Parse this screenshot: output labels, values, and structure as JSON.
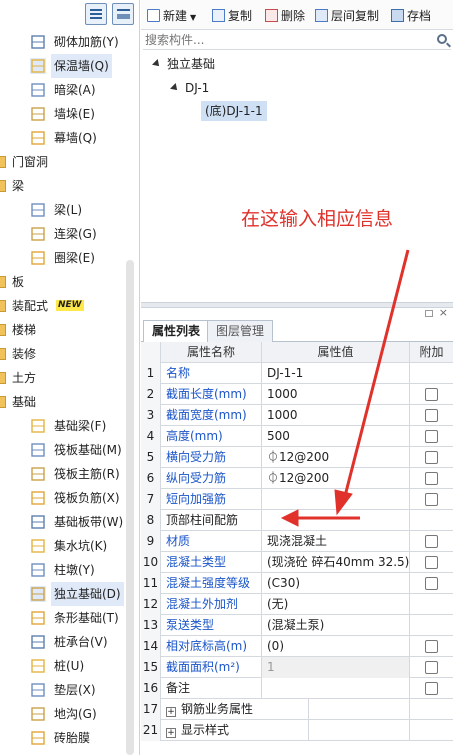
{
  "left_tree": {
    "items": [
      {
        "kind": "sub",
        "label": "砌体加筋(Y)",
        "icon": "masonry-rebar-icon"
      },
      {
        "kind": "sub",
        "label": "保温墙(Q)",
        "icon": "insulation-wall-icon",
        "selected": true
      },
      {
        "kind": "sub",
        "label": "暗梁(A)",
        "icon": "hidden-beam-icon"
      },
      {
        "kind": "sub",
        "label": "墙垛(E)",
        "icon": "wall-pier-icon"
      },
      {
        "kind": "sub",
        "label": "幕墙(Q)",
        "icon": "curtain-wall-icon"
      },
      {
        "kind": "cat",
        "label": "门窗洞"
      },
      {
        "kind": "cat",
        "label": "梁"
      },
      {
        "kind": "sub",
        "label": "梁(L)",
        "icon": "beam-icon"
      },
      {
        "kind": "sub",
        "label": "连梁(G)",
        "icon": "coupling-beam-icon"
      },
      {
        "kind": "sub",
        "label": "圈梁(E)",
        "icon": "ring-beam-icon"
      },
      {
        "kind": "cat",
        "label": "板"
      },
      {
        "kind": "cat",
        "label": "装配式",
        "badge": "NEW"
      },
      {
        "kind": "cat",
        "label": "楼梯"
      },
      {
        "kind": "cat",
        "label": "装修"
      },
      {
        "kind": "cat",
        "label": "土方"
      },
      {
        "kind": "cat",
        "label": "基础"
      },
      {
        "kind": "sub",
        "label": "基础梁(F)",
        "icon": "foundation-beam-icon"
      },
      {
        "kind": "sub",
        "label": "筏板基础(M)",
        "icon": "raft-foundation-icon"
      },
      {
        "kind": "sub",
        "label": "筏板主筋(R)",
        "icon": "raft-main-rebar-icon"
      },
      {
        "kind": "sub",
        "label": "筏板负筋(X)",
        "icon": "raft-negative-rebar-icon"
      },
      {
        "kind": "sub",
        "label": "基础板带(W)",
        "icon": "foundation-strip-icon"
      },
      {
        "kind": "sub",
        "label": "集水坑(K)",
        "icon": "sump-pit-icon"
      },
      {
        "kind": "sub",
        "label": "柱墩(Y)",
        "icon": "column-pier-icon"
      },
      {
        "kind": "sub",
        "label": "独立基础(D)",
        "icon": "isolated-footing-icon",
        "selected": true
      },
      {
        "kind": "sub",
        "label": "条形基础(T)",
        "icon": "strip-footing-icon"
      },
      {
        "kind": "sub",
        "label": "桩承台(V)",
        "icon": "pile-cap-icon"
      },
      {
        "kind": "sub",
        "label": "桩(U)",
        "icon": "pile-icon"
      },
      {
        "kind": "sub",
        "label": "垫层(X)",
        "icon": "cushion-layer-icon"
      },
      {
        "kind": "sub",
        "label": "地沟(G)",
        "icon": "trench-icon"
      },
      {
        "kind": "sub",
        "label": "砖胎膜",
        "icon": "brick-mold-icon"
      }
    ]
  },
  "toolbar": {
    "new_label": "新建",
    "copy_label": "复制",
    "delete_label": "删除",
    "floor_copy_label": "层间复制",
    "save_label": "存档"
  },
  "search": {
    "placeholder": "搜索构件..."
  },
  "component_tree": {
    "root": "独立基础",
    "child": "DJ-1",
    "leaf": "(底)DJ-1-1"
  },
  "annotation": {
    "text": "在这输入相应信息",
    "color": "#e0312b"
  },
  "tabs": {
    "properties": "属性列表",
    "layers": "图层管理"
  },
  "grid": {
    "headers": {
      "name": "属性名称",
      "value": "属性值",
      "add": "附加"
    },
    "rows": [
      {
        "idx": "1",
        "name": "名称",
        "value": "DJ-1-1",
        "blue": true,
        "check": false
      },
      {
        "idx": "2",
        "name": "截面长度(mm)",
        "value": "1000",
        "blue": true,
        "check": true
      },
      {
        "idx": "3",
        "name": "截面宽度(mm)",
        "value": "1000",
        "blue": true,
        "check": true
      },
      {
        "idx": "4",
        "name": "高度(mm)",
        "value": "500",
        "blue": true,
        "check": true
      },
      {
        "idx": "5",
        "name": "横向受力筋",
        "value": "⏀12@200",
        "blue": true,
        "check": true
      },
      {
        "idx": "6",
        "name": "纵向受力筋",
        "value": "⏀12@200",
        "blue": true,
        "check": true
      },
      {
        "idx": "7",
        "name": "短向加强筋",
        "value": "",
        "blue": true,
        "check": true
      },
      {
        "idx": "8",
        "name": "顶部柱间配筋",
        "value": "",
        "blue": false,
        "check": false
      },
      {
        "idx": "9",
        "name": "材质",
        "value": "现浇混凝土",
        "blue": true,
        "check": true
      },
      {
        "idx": "10",
        "name": "混凝土类型",
        "value": "(现浇砼 碎石40mm 32.5)",
        "blue": true,
        "check": true
      },
      {
        "idx": "11",
        "name": "混凝土强度等级",
        "value": "(C30)",
        "blue": true,
        "check": true
      },
      {
        "idx": "12",
        "name": "混凝土外加剂",
        "value": "(无)",
        "blue": true,
        "check": false
      },
      {
        "idx": "13",
        "name": "泵送类型",
        "value": "(混凝土泵)",
        "blue": true,
        "check": false
      },
      {
        "idx": "14",
        "name": "相对底标高(m)",
        "value": "(0)",
        "blue": true,
        "check": true
      },
      {
        "idx": "15",
        "name": "截面面积(m²)",
        "value": "1",
        "blue": true,
        "check": true,
        "gray": true
      },
      {
        "idx": "16",
        "name": "备注",
        "value": "",
        "blue": false,
        "check": true
      },
      {
        "idx": "17",
        "name": "钢筋业务属性",
        "value": "",
        "blue": false,
        "check": false,
        "expander": true
      },
      {
        "idx": "21",
        "name": "显示样式",
        "value": "",
        "blue": false,
        "check": false,
        "expander": true
      }
    ]
  }
}
